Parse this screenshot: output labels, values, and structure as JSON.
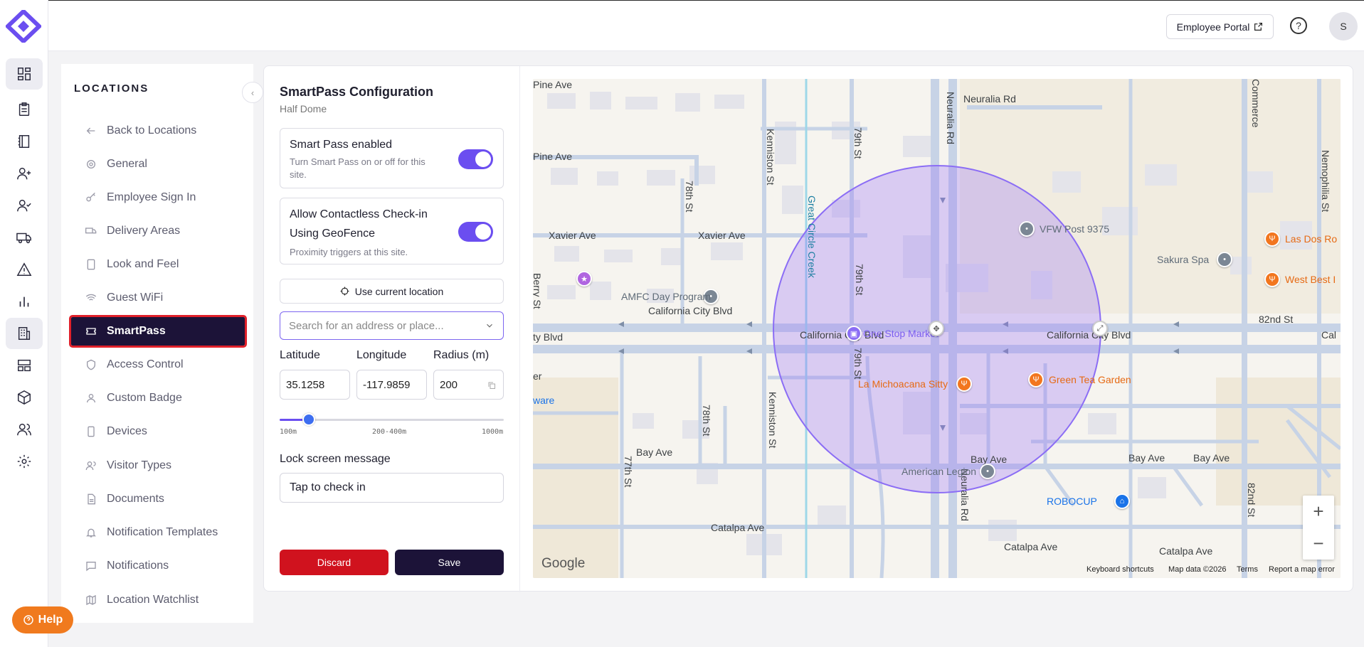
{
  "app": {
    "brand_color": "#6b4ef0",
    "accent_dark": "#1c1338"
  },
  "topbar": {
    "employee_portal_label": "Employee Portal",
    "avatar_initial": "S"
  },
  "rail": {
    "icons": [
      "dashboard-icon",
      "clipboard-icon",
      "logbook-icon",
      "add-user-icon",
      "user-check-icon",
      "truck-icon",
      "alert-icon",
      "chart-icon",
      "building-icon",
      "layout-icon",
      "cube-icon",
      "users-icon",
      "settings-icon"
    ]
  },
  "sidebar": {
    "heading": "LOCATIONS",
    "items": [
      {
        "label": "Back to Locations",
        "icon": "arrow-left-icon"
      },
      {
        "label": "General",
        "icon": "gear-icon"
      },
      {
        "label": "Employee Sign In",
        "icon": "key-icon"
      },
      {
        "label": "Delivery Areas",
        "icon": "truck-icon"
      },
      {
        "label": "Look and Feel",
        "icon": "tablet-icon"
      },
      {
        "label": "Guest WiFi",
        "icon": "wifi-icon"
      },
      {
        "label": "SmartPass",
        "icon": "ticket-icon"
      },
      {
        "label": "Access Control",
        "icon": "shield-icon"
      },
      {
        "label": "Custom Badge",
        "icon": "person-icon"
      },
      {
        "label": "Devices",
        "icon": "device-icon"
      },
      {
        "label": "Visitor Types",
        "icon": "people-icon"
      },
      {
        "label": "Documents",
        "icon": "document-icon"
      },
      {
        "label": "Notification Templates",
        "icon": "bell-icon"
      },
      {
        "label": "Notifications",
        "icon": "message-icon"
      },
      {
        "label": "Location Watchlist",
        "icon": "map-icon"
      }
    ]
  },
  "config": {
    "title": "SmartPass Configuration",
    "subtitle": "Half Dome",
    "smart_pass": {
      "title": "Smart Pass enabled",
      "desc_line1": "Turn Smart Pass on or off for this",
      "desc_line2": "site.",
      "enabled": true
    },
    "geofence": {
      "title_line1": "Allow Contactless Check-in",
      "title_line2": "Using GeoFence",
      "desc": "Proximity triggers at this site.",
      "enabled": true
    },
    "use_location_label": "Use current location",
    "search_placeholder": "Search for an address or place...",
    "latitude_label": "Latitude",
    "longitude_label": "Longitude",
    "radius_label": "Radius (m)",
    "latitude": "35.1258",
    "longitude": "-117.9859",
    "radius": "200",
    "slider": {
      "value_fraction": 0.13,
      "min_label": "100m",
      "mid_label": "200-400m",
      "max_label": "1000m"
    },
    "lock_label": "Lock screen message",
    "lock_value": "Tap to check in",
    "discard_label": "Discard",
    "save_label": "Save"
  },
  "map": {
    "streets": {
      "pine": "Pine Ave",
      "xavier1": "Xavier Ave",
      "xavier2": "Xavier Ave",
      "california1": "California City Blvd",
      "california2": "California City Blvd",
      "california3": "California City Blvd",
      "california_left": "ty Blvd",
      "california_right": "Cal",
      "bay1": "Bay Ave",
      "bay2": "Bay Ave",
      "bay3": "Bay Ave",
      "bay4": "Bay Ave",
      "catalpa1": "Catalpa Ave",
      "catalpa2": "Catalpa Ave",
      "catalpa3": "Catalpa Ave",
      "neuralia1": "Neuralia Rd",
      "neuralia2": "Neuralia Rd",
      "kenniston1": "Kenniston St",
      "kenniston2": "Kenniston St",
      "st79_1": "79th St",
      "st79_2": "79th St",
      "st79_3": "79th St",
      "st78_1": "78th St",
      "st78_2": "78th St",
      "st77": "77th St",
      "st82a": "82nd St",
      "st82b": "82nd St",
      "great_circle": "Great Circle Creek",
      "commerce": "Commerce",
      "nemophilia": "Nemophilia St",
      "berry": "Berry St",
      "er": "er",
      "ware": "ware"
    },
    "places": {
      "vfw": "VFW Post 9375",
      "sakura": "Sakura Spa",
      "las_dos": "Las Dos Ro",
      "west_best": "West Best I",
      "amfc": "AMFC Day Program",
      "one_stop": "One Stop Market",
      "la_michoacana": "La Michoacana Sitty",
      "green_tea": "Green Tea Garden",
      "american_legion": "American Legion",
      "robocup": "ROBOCUP"
    },
    "zoom_in": "+",
    "zoom_out": "−",
    "google_logo": "Google",
    "keyboard_shortcuts": "Keyboard shortcuts",
    "map_data": "Map data ©2026",
    "terms": "Terms",
    "report": "Report a map error"
  },
  "help": {
    "label": "Help"
  }
}
